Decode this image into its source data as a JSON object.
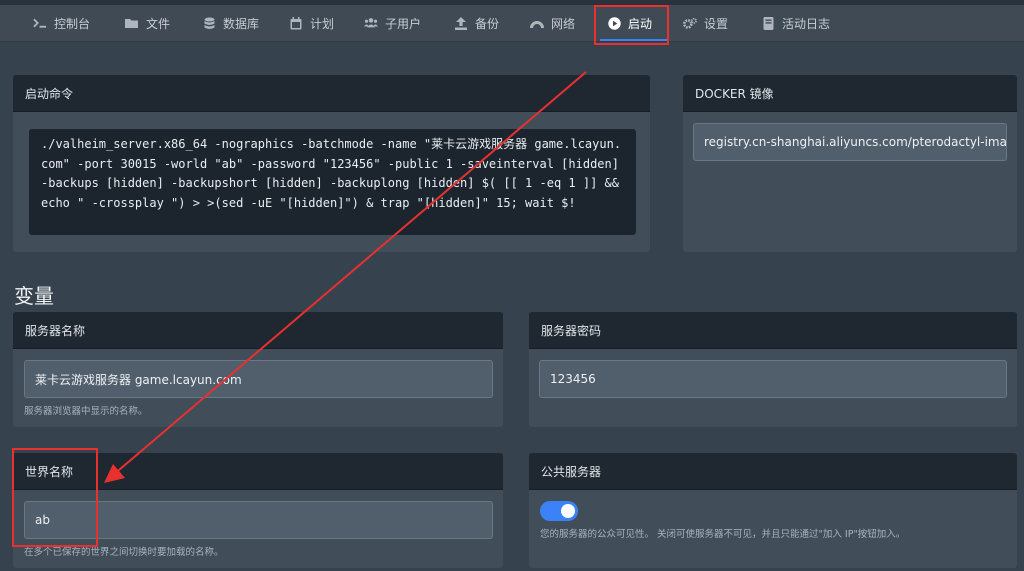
{
  "tabs": [
    {
      "label": "控制台",
      "icon": "terminal-icon"
    },
    {
      "label": "文件",
      "icon": "folder-icon"
    },
    {
      "label": "数据库",
      "icon": "database-icon"
    },
    {
      "label": "计划",
      "icon": "calendar-icon"
    },
    {
      "label": "子用户",
      "icon": "users-icon"
    },
    {
      "label": "备份",
      "icon": "upload-icon"
    },
    {
      "label": "网络",
      "icon": "network-icon"
    },
    {
      "label": "启动",
      "icon": "play-icon",
      "active": true
    },
    {
      "label": "设置",
      "icon": "gears-icon"
    },
    {
      "label": "活动日志",
      "icon": "book-icon"
    }
  ],
  "startup": {
    "title": "启动命令",
    "command": "./valheim_server.x86_64 -nographics -batchmode -name \"莱卡云游戏服务器 game.lcayun.com\" -port 30015 -world \"ab\" -password \"123456\" -public 1 -saveinterval [hidden] -backups [hidden] -backupshort [hidden] -backuplong [hidden] $( [[ 1 -eq 1 ]] && echo \" -crossplay \") > >(sed -uE \"[hidden]\") & trap \"[hidden]\" 15; wait $!"
  },
  "docker": {
    "title": "DOCKER 镜像",
    "value": "registry.cn-shanghai.aliyuncs.com/pterodactyl-images/yolks:debian"
  },
  "variables": {
    "title": "变量",
    "server_name": {
      "label": "服务器名称",
      "value": "莱卡云游戏服务器 game.lcayun.com",
      "help": "服务器浏览器中显示的名称。"
    },
    "server_password": {
      "label": "服务器密码",
      "value": "123456"
    },
    "world_name": {
      "label": "世界名称",
      "value": "ab",
      "help": "在多个已保存的世界之间切换时要加载的名称。"
    },
    "public_server": {
      "label": "公共服务器",
      "enabled": true,
      "help": "您的服务器的公众可见性。 关闭可使服务器不可见，并且只能通过\"加入 IP\"按钮加入。"
    }
  },
  "colors": {
    "annotation": "#e8312f",
    "accent": "#3b82f6"
  }
}
